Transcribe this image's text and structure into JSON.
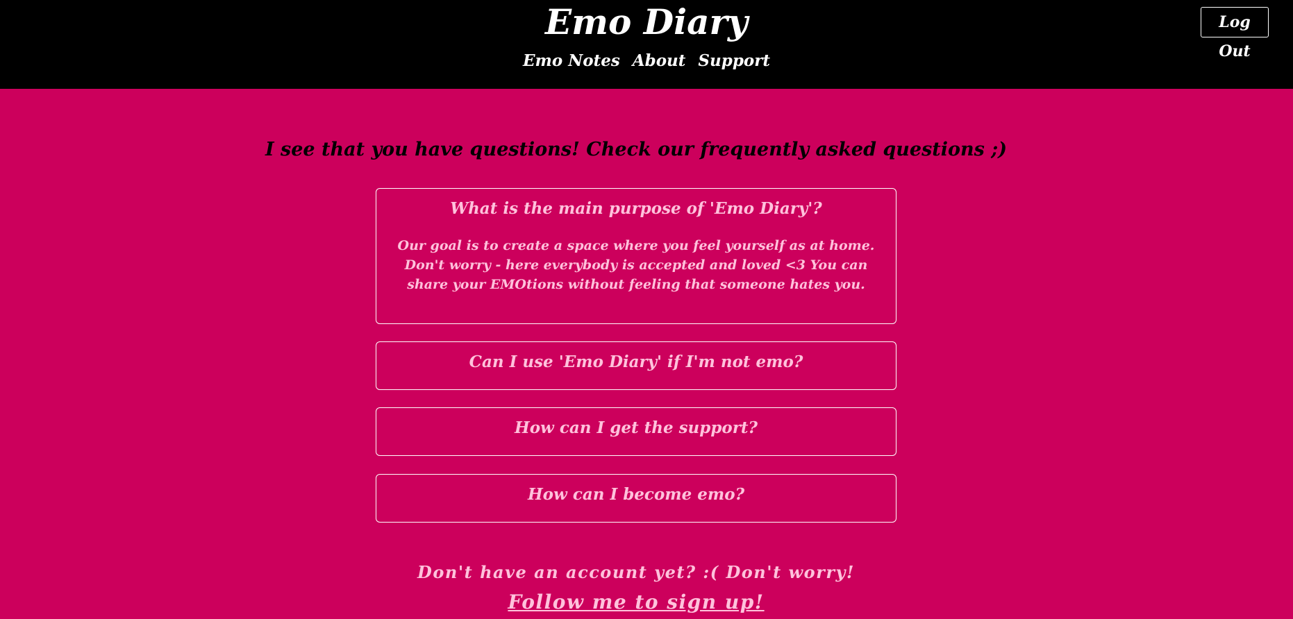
{
  "header": {
    "title": "Emo Diary",
    "nav": [
      {
        "label": "Emo Notes"
      },
      {
        "label": "About"
      },
      {
        "label": "Support"
      }
    ],
    "logout_label": "Log Out"
  },
  "main": {
    "heading": "I see that you have questions! Check our frequently asked questions ;)",
    "faqs": [
      {
        "question": "What is the main purpose of 'Emo Diary'?",
        "answer": "Our goal is to create a space where you feel yourself as at home. Don't worry - here everybody is accepted and loved <3 You can share your EMOtions without feeling that someone hates you.",
        "expanded": true
      },
      {
        "question": "Can I use 'Emo Diary' if I'm not emo?",
        "expanded": false
      },
      {
        "question": "How can I get the support?",
        "expanded": false
      },
      {
        "question": "How can I become emo?",
        "expanded": false
      }
    ]
  },
  "footer": {
    "signup_prompt": "Don't have an account yet? :( Don't worry!",
    "signup_link": "Follow me to sign up!"
  },
  "colors": {
    "header_bg": "#000000",
    "page_bg": "#cc005c",
    "accent_text": "#ffc2dc",
    "heading_text": "#000000",
    "border": "#ffffff"
  }
}
